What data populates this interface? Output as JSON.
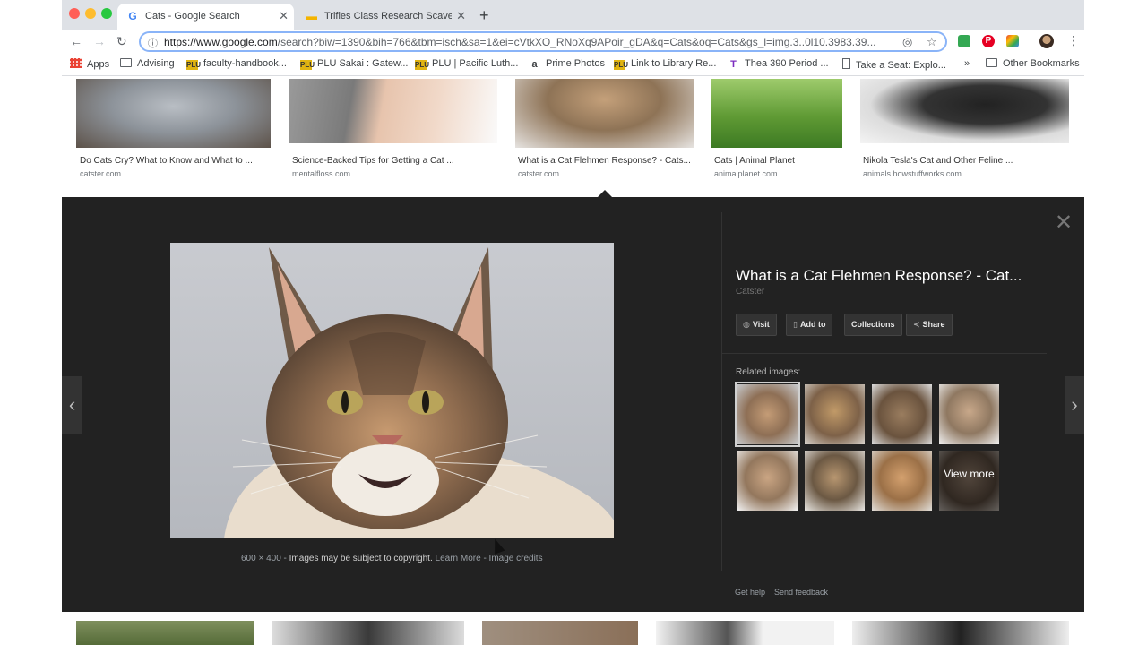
{
  "browser": {
    "tabs": [
      {
        "favicon": "G",
        "label": "Cats - Google Search",
        "close": "✕"
      },
      {
        "favicon": "▬",
        "label": "Trifles Class Research Scaveng",
        "close": "✕"
      }
    ],
    "new_tab": "+",
    "url_domain": "https://www.google.com",
    "url_rest": "/search?biw=1390&bih=766&tbm=isch&sa=1&ei=cVtkXO_RNoXq9APoir_gDA&q=Cats&oq=Cats&gs_l=img.3..0l10.3983.39...",
    "bookmarks": [
      {
        "icon": "apps",
        "label": "Apps"
      },
      {
        "icon": "folder",
        "label": "Advising"
      },
      {
        "icon": "plu",
        "label": "faculty-handbook..."
      },
      {
        "icon": "plu",
        "label": "PLU Sakai : Gatew..."
      },
      {
        "icon": "plu",
        "label": "PLU | Pacific Luth..."
      },
      {
        "icon": "amazon",
        "label": "Prime Photos"
      },
      {
        "icon": "plu",
        "label": "Link to Library Re..."
      },
      {
        "icon": "t",
        "label": "Thea 390 Period ..."
      },
      {
        "icon": "doc",
        "label": "Take a Seat: Explo..."
      }
    ],
    "bookmarks_overflow": "»",
    "other_bookmarks": "Other Bookmarks"
  },
  "results": [
    {
      "title": "Do Cats Cry? What to Know and What to ...",
      "source": "catster.com"
    },
    {
      "title": "Science-Backed Tips for Getting a Cat ...",
      "source": "mentalfloss.com"
    },
    {
      "title": "What is a Cat Flehmen Response? - Cats...",
      "source": "catster.com"
    },
    {
      "title": "Cats | Animal Planet",
      "source": "animalplanet.com"
    },
    {
      "title": "Nikola Tesla's Cat and Other Feline ...",
      "source": "animals.howstuffworks.com"
    }
  ],
  "preview": {
    "title": "What is a Cat Flehmen Response? - Cat...",
    "source": "Catster",
    "actions": [
      {
        "icon": "globe",
        "label": "Visit"
      },
      {
        "icon": "bookmark",
        "label": "Add to"
      },
      {
        "icon": "",
        "label": "Collections"
      },
      {
        "icon": "share",
        "label": "Share"
      }
    ],
    "related_label": "Related images:",
    "view_more": "View more",
    "dimensions": "600 × 400",
    "copyright": "Images may be subject to copyright.",
    "learn_more": "Learn More",
    "image_credits": "Image credits",
    "get_help": "Get help",
    "send_feedback": "Send feedback",
    "close": "✕",
    "prev": "‹",
    "next": "›"
  }
}
